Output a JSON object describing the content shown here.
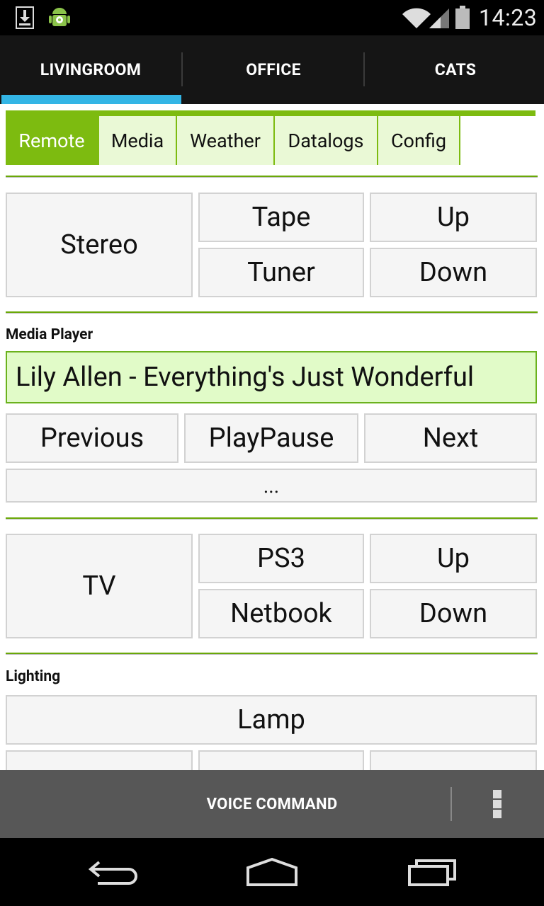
{
  "status": {
    "time": "14:23"
  },
  "tabs": [
    {
      "label": "LIVINGROOM"
    },
    {
      "label": "OFFICE"
    },
    {
      "label": "CATS"
    }
  ],
  "subtabs": [
    {
      "label": "Remote"
    },
    {
      "label": "Media"
    },
    {
      "label": "Weather"
    },
    {
      "label": "Datalogs"
    },
    {
      "label": "Config"
    }
  ],
  "stereo": {
    "main": "Stereo",
    "source1": "Tape",
    "source2": "Tuner",
    "up": "Up",
    "down": "Down"
  },
  "media_player": {
    "heading": "Media Player",
    "now_playing": "Lily Allen - Everything's Just Wonderful",
    "previous": "Previous",
    "playpause": "PlayPause",
    "next": "Next",
    "more": "..."
  },
  "tv": {
    "main": "TV",
    "source1": "PS3",
    "source2": "Netbook",
    "up": "Up",
    "down": "Down"
  },
  "lighting": {
    "heading": "Lighting",
    "lamp": "Lamp"
  },
  "bottom_bar": {
    "voice_command": "VOICE COMMAND"
  },
  "colors": {
    "accent_green": "#7dbb10",
    "tab_indicator": "#33b5e5",
    "now_playing_bg": "#e1fbc8"
  }
}
